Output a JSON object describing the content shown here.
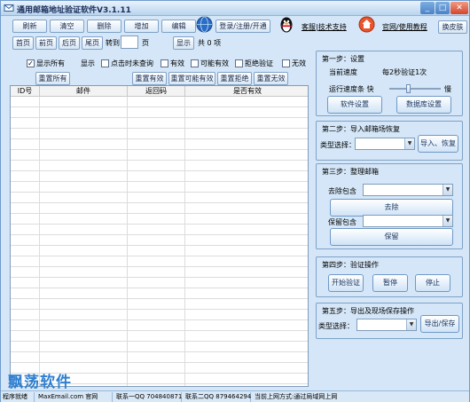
{
  "window": {
    "title": "通用邮箱地址验证软件V3.1.11",
    "min_glyph": "_",
    "max_glyph": "□",
    "close_glyph": "✕"
  },
  "toolbar": {
    "refresh": "刷新",
    "clear": "清空",
    "delete": "删除",
    "add": "增加",
    "edit": "编辑",
    "login": "登录/注册/开通",
    "support": "客服|技术支持",
    "website": "官网/使用教程",
    "skin": "换皮肤"
  },
  "pager": {
    "first": "首页",
    "prev": "前页",
    "next": "后页",
    "last": "尾页",
    "goto_label": "转到",
    "page_value": "",
    "page_unit": "页",
    "show": "显示",
    "total": "共 0 项"
  },
  "filters": {
    "show_all": "显示所有",
    "show_label": "显示",
    "timeout": "点击时未查询",
    "valid": "有效",
    "maybe_valid": "可能有效",
    "reject": "拒绝验证",
    "invalid": "无效",
    "show_all_checked": true,
    "timeout_checked": false,
    "valid_checked": false,
    "maybe_checked": false,
    "reject_checked": false,
    "invalid_checked": false
  },
  "quick_buttons": {
    "check_all": "重置所有",
    "check_valid": "重置有效",
    "check_maybe": "重置可能有效",
    "check_reject": "重置拒绝",
    "check_invalid": "重置无效"
  },
  "table": {
    "columns": [
      "ID号",
      "邮件",
      "返回码",
      "是否有效"
    ],
    "rows": []
  },
  "step1": {
    "title": "第一步：设置",
    "speed_label": "当前速度",
    "speed_value": "每2秒验证1次",
    "speed_adjust_label": "运行速度条 快",
    "speed_slow": "慢",
    "speed_level": 0.35,
    "software_settings": "软件设置",
    "db_settings": "数据库设置"
  },
  "step2": {
    "title": "第二步：导入邮箱场恢复",
    "type_label": "类型选择：",
    "type_value": "",
    "import_button": "导入、恢复"
  },
  "step3": {
    "title": "第三步：整理邮箱",
    "remove_label": "去除包含",
    "remove_value": "",
    "remove_button": "去除",
    "keep_label": "保留包含",
    "keep_value": "",
    "keep_button": "保留"
  },
  "step4": {
    "title": "第四步：验证操作",
    "start": "开始验证",
    "pause": "暂停",
    "stop": "停止"
  },
  "step5": {
    "title": "第五步：导出及现场保存操作",
    "type_label": "类型选择：",
    "type_value": "",
    "export_button": "导出/保存"
  },
  "status": {
    "ready": "程序就绪",
    "site": "MaxEmail.com 官网",
    "qq1": "联系一QQ 704840871",
    "qq2": "联系二QQ 879464294",
    "net": "当前上网方式:通过局域网上网"
  },
  "watermark": "飘荡软件",
  "colors": {
    "window_bg": "#d4e6f7",
    "accent": "#4a82c7",
    "watermark": "#2f7fd0"
  }
}
